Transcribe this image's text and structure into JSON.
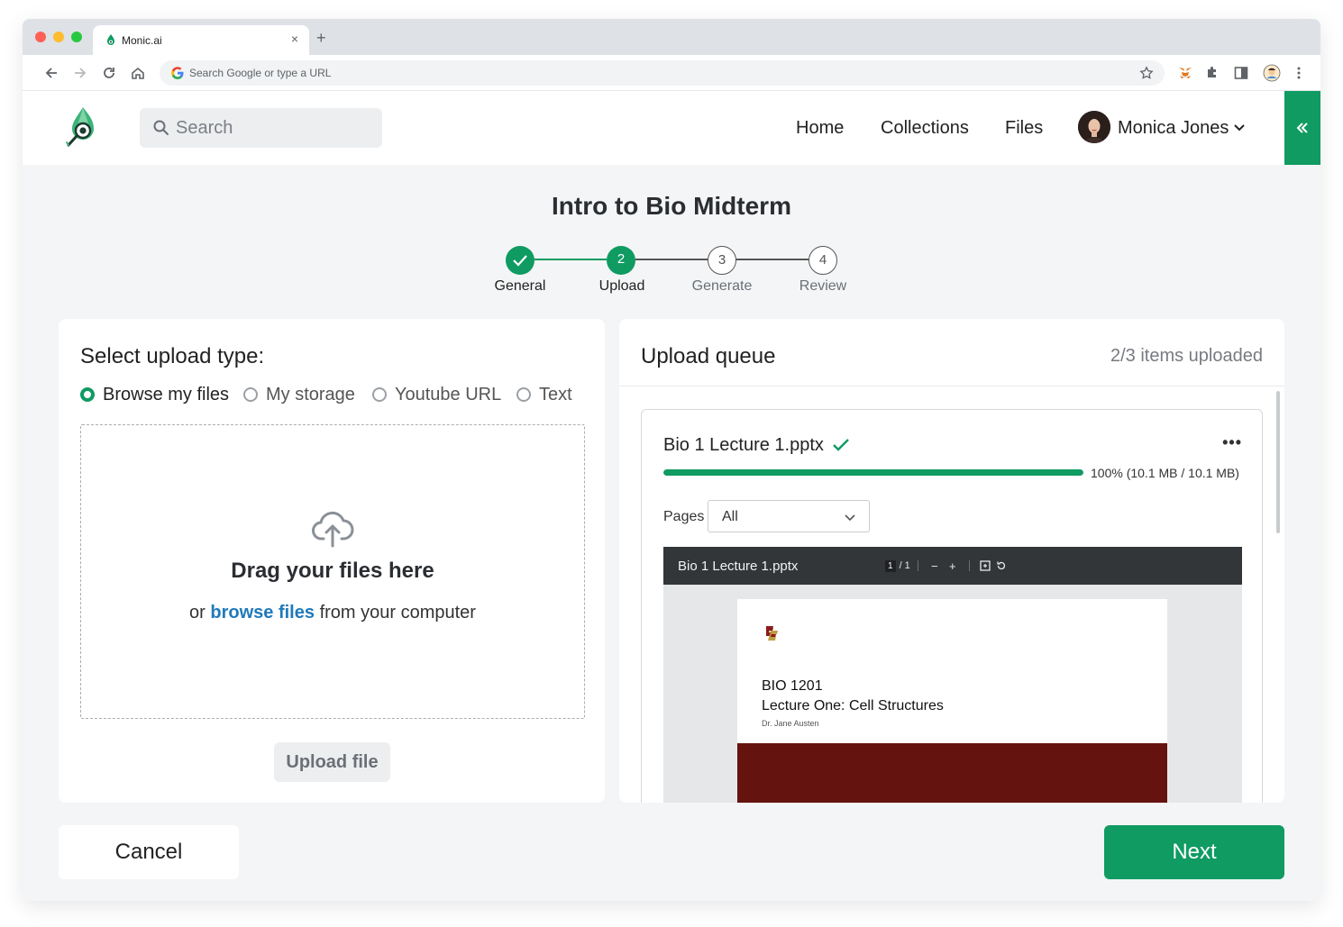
{
  "browser": {
    "tab_title": "Monic.ai",
    "tab_close": "×",
    "new_tab": "+",
    "omnibox_placeholder": "Search Google or type a URL"
  },
  "header": {
    "search_placeholder": "Search",
    "nav": [
      "Home",
      "Collections",
      "Files"
    ],
    "user_name": "Monica Jones"
  },
  "page": {
    "title": "Intro to Bio Midterm"
  },
  "stepper": {
    "steps": [
      {
        "number": "",
        "label": "General",
        "state": "complete"
      },
      {
        "number": "2",
        "label": "Upload",
        "state": "active"
      },
      {
        "number": "3",
        "label": "Generate",
        "state": "pending"
      },
      {
        "number": "4",
        "label": "Review",
        "state": "pending"
      }
    ]
  },
  "upload_type": {
    "title": "Select upload type:",
    "options": [
      {
        "label": "Browse my files",
        "selected": true
      },
      {
        "label": "My storage",
        "selected": false
      },
      {
        "label": "Youtube URL",
        "selected": false
      },
      {
        "label": "Text",
        "selected": false
      }
    ],
    "dropzone_title": "Drag your files here",
    "dropzone_prefix": "or",
    "dropzone_link": "browse files",
    "dropzone_suffix": "from your computer",
    "upload_button": "Upload file"
  },
  "queue": {
    "title": "Upload queue",
    "count_text": "2/3 items uploaded",
    "item": {
      "file_name": "Bio 1 Lecture 1.pptx",
      "more": "•••",
      "progress": 1.0,
      "progress_text": "100% (10.1 MB / 10.1 MB)",
      "pages_label": "Pages",
      "pages_value": "All",
      "viewer": {
        "title": "Bio 1 Lecture 1.pptx",
        "page_current": "1",
        "page_total": "/ 1",
        "zoom_out": "−",
        "zoom_in": "+"
      },
      "slide": {
        "course": "BIO 1201",
        "lecture": "Lecture One: Cell Structures",
        "author": "Dr. Jane Austen"
      }
    }
  },
  "footer": {
    "cancel": "Cancel",
    "next": "Next"
  },
  "colors": {
    "brand_green": "#0f9b62",
    "link_blue": "#1f7ab8",
    "slide_band": "#65130f"
  }
}
